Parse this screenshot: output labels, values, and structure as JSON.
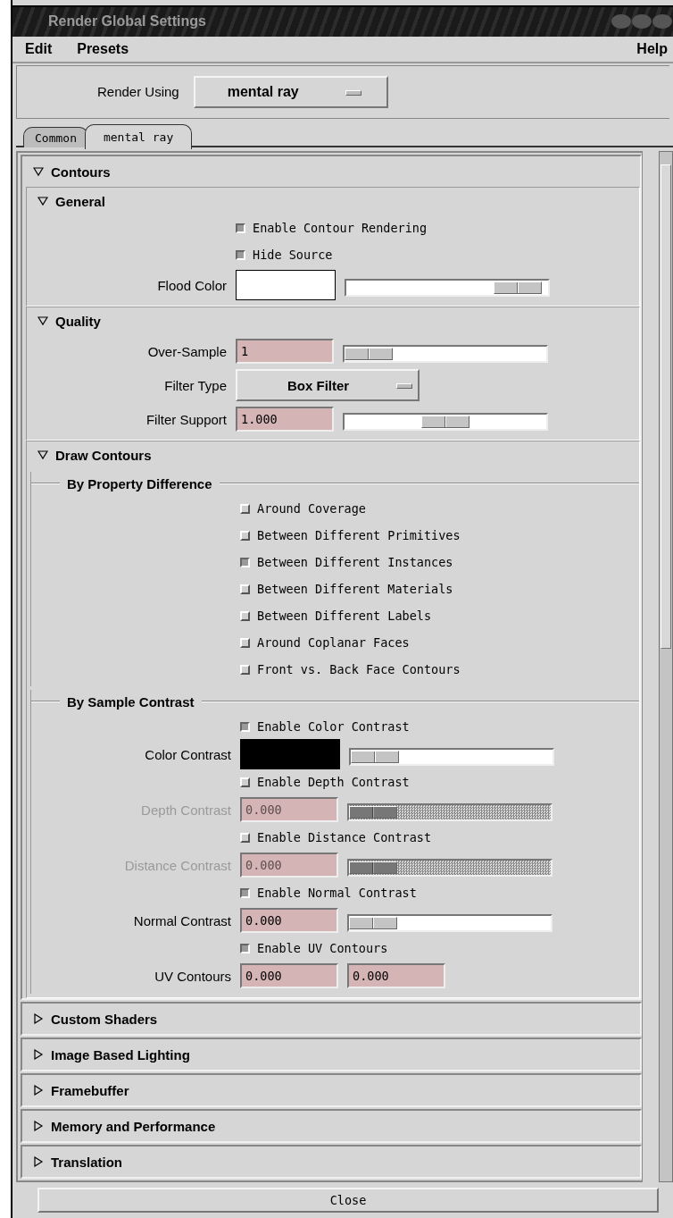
{
  "window": {
    "title": "Render Global Settings"
  },
  "menu": [
    {
      "label": "Edit"
    },
    {
      "label": "Presets"
    }
  ],
  "help_menu": {
    "label": "Help"
  },
  "render_using": {
    "label": "Render Using",
    "value": "mental ray"
  },
  "tabs": [
    {
      "label": "Common",
      "selected": false
    },
    {
      "label": "mental ray",
      "selected": true
    }
  ],
  "sections": [
    {
      "title": "Contours",
      "expanded": true,
      "children": [
        {
          "title": "General",
          "expanded": true,
          "rows": [
            {
              "kind": "checkbox",
              "label": "Enable Contour Rendering",
              "checked": true
            },
            {
              "kind": "checkbox",
              "label": "Hide Source",
              "checked": true
            },
            {
              "kind": "color",
              "label": "Flood Color",
              "color": "#ffffff",
              "level": 0.85
            }
          ]
        },
        {
          "title": "Quality",
          "expanded": true,
          "rows": [
            {
              "kind": "number",
              "label": "Over-Sample",
              "value": "1",
              "level": 0.12,
              "disabled": false
            },
            {
              "kind": "dropdown",
              "label": "Filter Type",
              "value": "Box Filter"
            },
            {
              "kind": "number",
              "label": "Filter Support",
              "value": "1.000",
              "level": 0.5,
              "disabled": false
            }
          ]
        },
        {
          "title": "Draw Contours",
          "expanded": true,
          "groups": [
            {
              "title": "By Property Difference",
              "rows": [
                {
                  "kind": "checkbox",
                  "label": "Around Coverage",
                  "checked": false
                },
                {
                  "kind": "checkbox",
                  "label": "Between Different Primitives",
                  "checked": false
                },
                {
                  "kind": "checkbox",
                  "label": "Between Different Instances",
                  "checked": true
                },
                {
                  "kind": "checkbox",
                  "label": "Between Different Materials",
                  "checked": false
                },
                {
                  "kind": "checkbox",
                  "label": "Between Different Labels",
                  "checked": false
                },
                {
                  "kind": "checkbox",
                  "label": "Around Coplanar Faces",
                  "checked": false
                },
                {
                  "kind": "checkbox",
                  "label": "Front vs. Back Face Contours",
                  "checked": false
                }
              ]
            },
            {
              "title": "By Sample Contrast",
              "rows": [
                {
                  "kind": "checkbox",
                  "label": "Enable Color Contrast",
                  "checked": true
                },
                {
                  "kind": "color",
                  "label": "Color Contrast",
                  "color": "#000000",
                  "level": 0.12
                },
                {
                  "kind": "checkbox",
                  "label": "Enable Depth Contrast",
                  "checked": false
                },
                {
                  "kind": "number",
                  "label": "Depth Contrast",
                  "value": "0.000",
                  "level": 0.12,
                  "disabled": true
                },
                {
                  "kind": "checkbox",
                  "label": "Enable Distance Contrast",
                  "checked": false
                },
                {
                  "kind": "number",
                  "label": "Distance Contrast",
                  "value": "0.000",
                  "level": 0.12,
                  "disabled": true
                },
                {
                  "kind": "checkbox",
                  "label": "Enable Normal Contrast",
                  "checked": true
                },
                {
                  "kind": "number",
                  "label": "Normal Contrast",
                  "value": "0.000",
                  "level": 0.12,
                  "disabled": false
                },
                {
                  "kind": "checkbox",
                  "label": "Enable UV Contours",
                  "checked": true
                },
                {
                  "kind": "pair",
                  "label": "UV Contours",
                  "values": [
                    "0.000",
                    "0.000"
                  ]
                }
              ]
            }
          ]
        }
      ]
    },
    {
      "title": "Custom Shaders",
      "expanded": false
    },
    {
      "title": "Image Based Lighting",
      "expanded": false
    },
    {
      "title": "Framebuffer",
      "expanded": false
    },
    {
      "title": "Memory and Performance",
      "expanded": false
    },
    {
      "title": "Translation",
      "expanded": false
    }
  ],
  "close_button": {
    "label": "Close"
  }
}
